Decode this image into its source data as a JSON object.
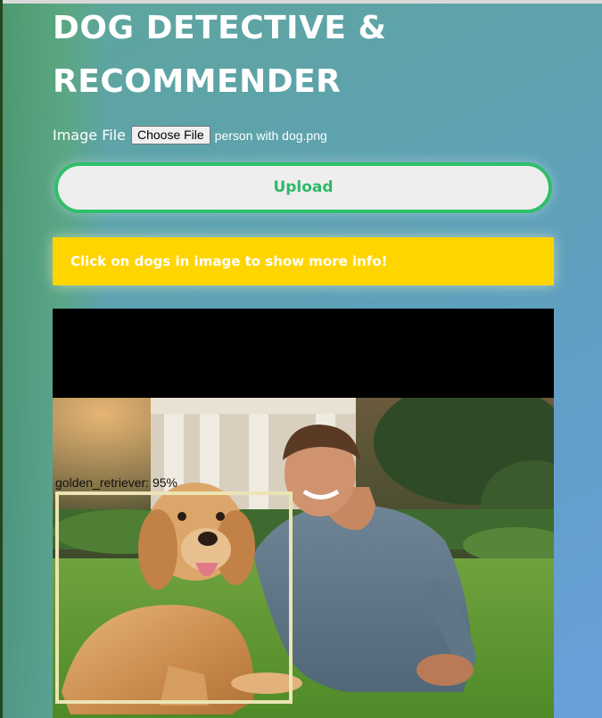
{
  "header": {
    "title_line1": "DOG DETECTIVE &",
    "title_line2": "RECOMMENDER"
  },
  "file_input": {
    "label": "Image File",
    "button_label": "Choose File",
    "file_name": "person with dog.png"
  },
  "upload": {
    "label": "Upload"
  },
  "banner": {
    "text": "Click on dogs in image to show more info!"
  },
  "detection": {
    "label": "golden_retriever: 95%",
    "box_color": "#ece4b4"
  },
  "colors": {
    "accent_green": "#2fbf6a",
    "banner_yellow": "#ffd500"
  }
}
